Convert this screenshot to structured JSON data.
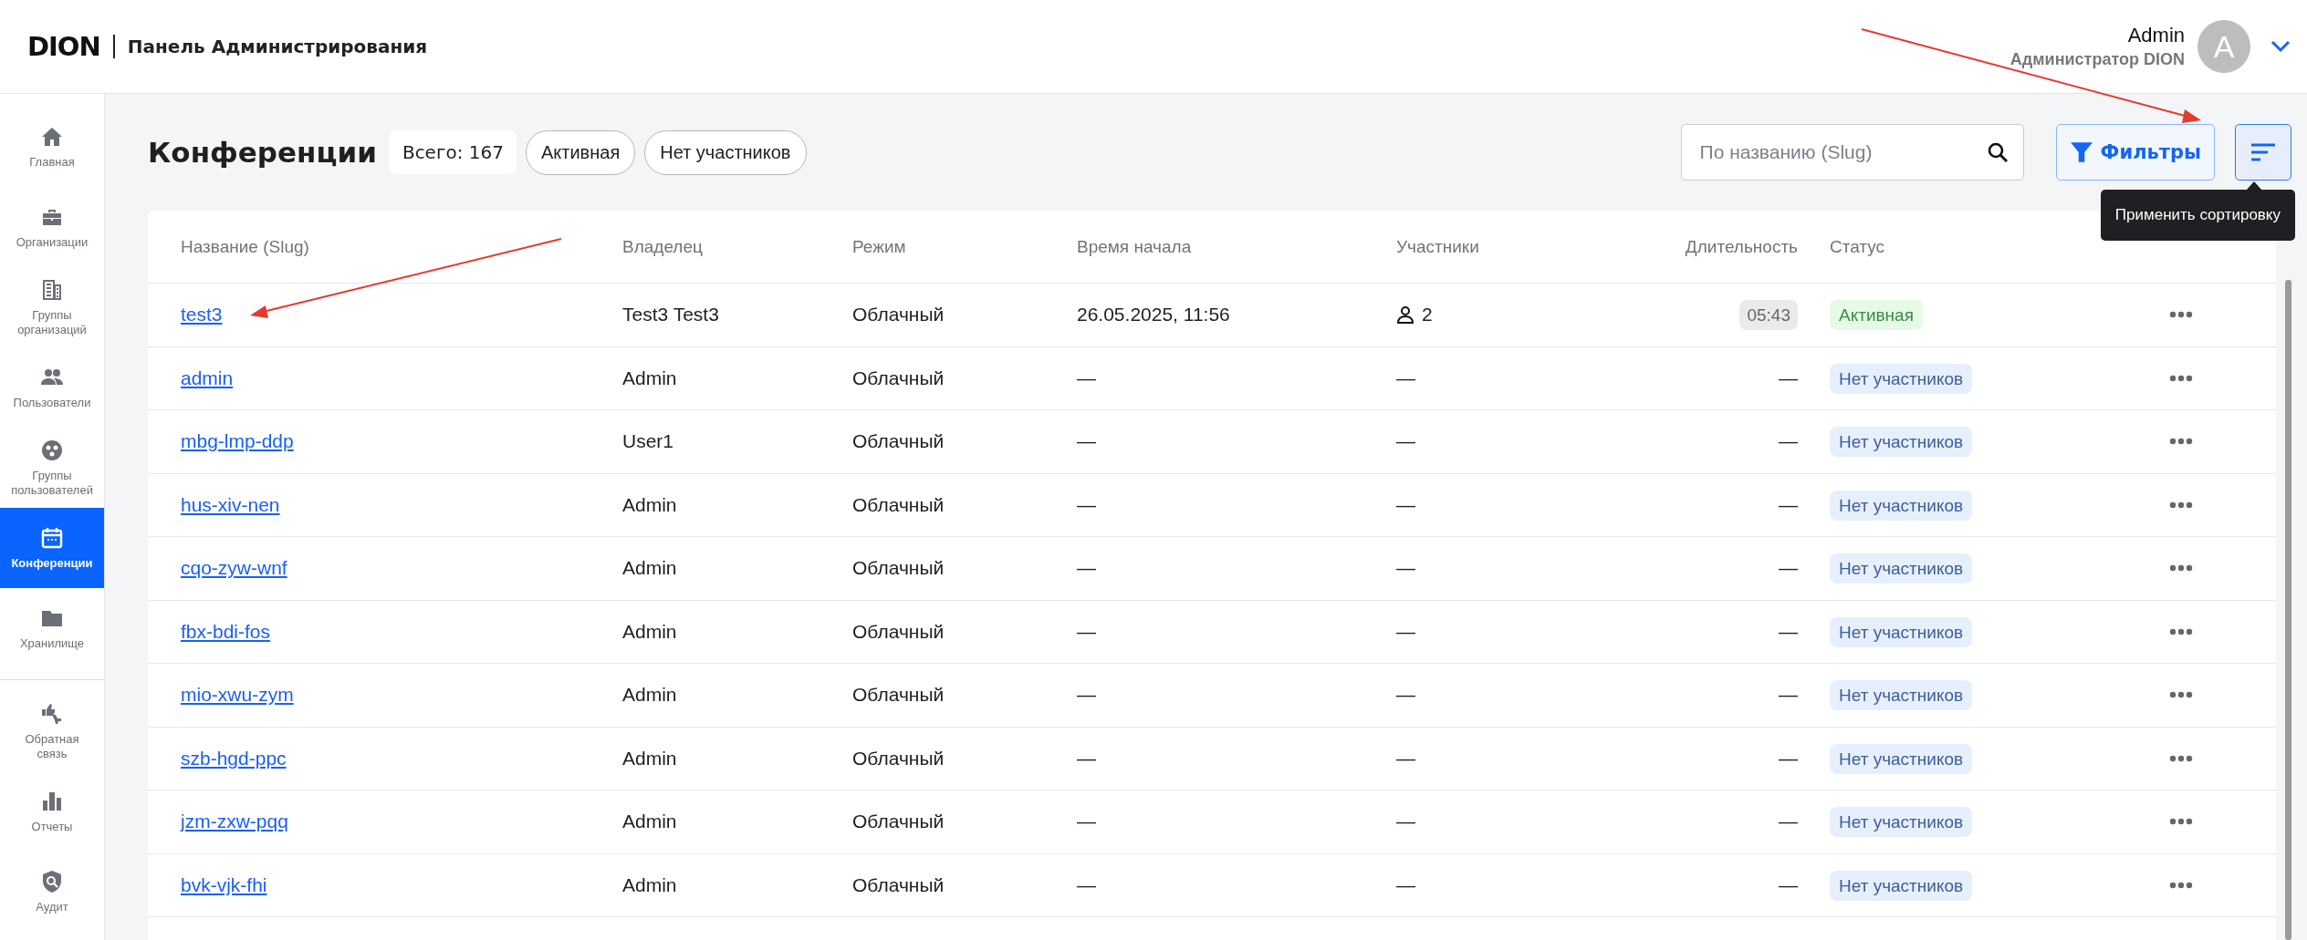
{
  "header": {
    "logo": "DION",
    "title": "Панель Администрирования",
    "user": {
      "name": "Admin",
      "role": "Администратор DION",
      "avatar_letter": "A"
    }
  },
  "sidebar": {
    "items": [
      {
        "label": "Главная",
        "selected": false
      },
      {
        "label": "Организации",
        "selected": false
      },
      {
        "label": "Группы организаций",
        "selected": false
      },
      {
        "label": "Пользователи",
        "selected": false
      },
      {
        "label": "Группы пользователей",
        "selected": false
      },
      {
        "label": "Конференции",
        "selected": true
      },
      {
        "label": "Хранилище",
        "selected": false
      },
      {
        "label": "Обратная связь",
        "selected": false,
        "divider_before": true
      },
      {
        "label": "Отчеты",
        "selected": false
      },
      {
        "label": "Аудит",
        "selected": false
      }
    ]
  },
  "page": {
    "title": "Конференции",
    "total": "Всего: 167",
    "chips": [
      "Активная",
      "Нет участников"
    ],
    "search": {
      "placeholder": "По названию (Slug)"
    },
    "filter_button": "Фильтры",
    "sort_button": {
      "selected": true,
      "tooltip": "Применить сортировку"
    }
  },
  "table": {
    "columns": [
      "Название (Slug)",
      "Владелец",
      "Режим",
      "Время начала",
      "Участники",
      "Длительность",
      "Статус"
    ],
    "rows": [
      {
        "slug": "test3",
        "owner": "Test3 Test3",
        "mode": "Облачный",
        "start": "26.05.2025, 11:56",
        "participants": {
          "text": "2",
          "icon": true
        },
        "duration": {
          "text": "05:43",
          "kind": "badge"
        },
        "status": {
          "text": "Активная",
          "kind": "active"
        }
      },
      {
        "slug": "admin",
        "owner": "Admin",
        "mode": "Облачный",
        "start": "—",
        "participants": {
          "text": "—",
          "icon": false
        },
        "duration": {
          "text": "—",
          "kind": "plain"
        },
        "status": {
          "text": "Нет участников",
          "kind": "empty"
        }
      },
      {
        "slug": "mbg-lmp-ddp",
        "owner": "User1",
        "mode": "Облачный",
        "start": "—",
        "participants": {
          "text": "—",
          "icon": false
        },
        "duration": {
          "text": "—",
          "kind": "plain"
        },
        "status": {
          "text": "Нет участников",
          "kind": "empty"
        }
      },
      {
        "slug": "hus-xiv-nen",
        "owner": "Admin",
        "mode": "Облачный",
        "start": "—",
        "participants": {
          "text": "—",
          "icon": false
        },
        "duration": {
          "text": "—",
          "kind": "plain"
        },
        "status": {
          "text": "Нет участников",
          "kind": "empty"
        }
      },
      {
        "slug": "cqo-zyw-wnf",
        "owner": "Admin",
        "mode": "Облачный",
        "start": "—",
        "participants": {
          "text": "—",
          "icon": false
        },
        "duration": {
          "text": "—",
          "kind": "plain"
        },
        "status": {
          "text": "Нет участников",
          "kind": "empty"
        }
      },
      {
        "slug": "fbx-bdi-fos",
        "owner": "Admin",
        "mode": "Облачный",
        "start": "—",
        "participants": {
          "text": "—",
          "icon": false
        },
        "duration": {
          "text": "—",
          "kind": "plain"
        },
        "status": {
          "text": "Нет участников",
          "kind": "empty"
        }
      },
      {
        "slug": "mio-xwu-zym",
        "owner": "Admin",
        "mode": "Облачный",
        "start": "—",
        "participants": {
          "text": "—",
          "icon": false
        },
        "duration": {
          "text": "—",
          "kind": "plain"
        },
        "status": {
          "text": "Нет участников",
          "kind": "empty"
        }
      },
      {
        "slug": "szb-hgd-ppc",
        "owner": "Admin",
        "mode": "Облачный",
        "start": "—",
        "participants": {
          "text": "—",
          "icon": false
        },
        "duration": {
          "text": "—",
          "kind": "plain"
        },
        "status": {
          "text": "Нет участников",
          "kind": "empty"
        }
      },
      {
        "slug": "jzm-zxw-pqq",
        "owner": "Admin",
        "mode": "Облачный",
        "start": "—",
        "participants": {
          "text": "—",
          "icon": false
        },
        "duration": {
          "text": "—",
          "kind": "plain"
        },
        "status": {
          "text": "Нет участников",
          "kind": "empty"
        }
      },
      {
        "slug": "bvk-vjk-fhi",
        "owner": "Admin",
        "mode": "Облачный",
        "start": "—",
        "participants": {
          "text": "—",
          "icon": false
        },
        "duration": {
          "text": "—",
          "kind": "plain"
        },
        "status": {
          "text": "Нет участников",
          "kind": "empty"
        }
      }
    ]
  }
}
